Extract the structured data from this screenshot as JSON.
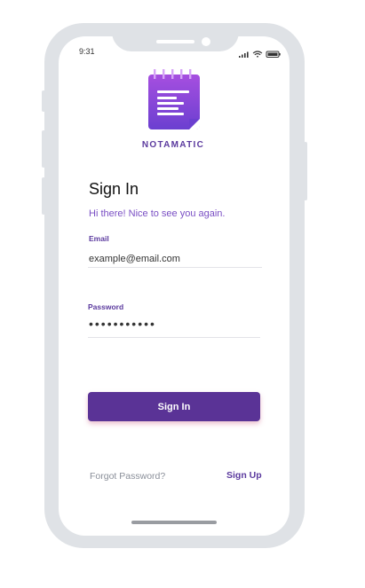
{
  "status_bar": {
    "time": "9:31"
  },
  "brand": {
    "name": "NOTAMATIC"
  },
  "signin": {
    "title": "Sign In",
    "subtitle": "Hi there! Nice to see you again."
  },
  "email": {
    "label": "Email",
    "value": "example@email.com"
  },
  "password": {
    "label": "Password",
    "mask": "•••••••••••"
  },
  "buttons": {
    "sign_in": "Sign In",
    "forgot_password": "Forgot Password?",
    "sign_up": "Sign Up"
  },
  "colors": {
    "primary": "#5a3396",
    "accent_text": "#7a4fc4",
    "frame": "#dfe2e6"
  },
  "icons": [
    "notepad-logo-icon",
    "signal-icon",
    "wifi-icon",
    "battery-icon"
  ]
}
